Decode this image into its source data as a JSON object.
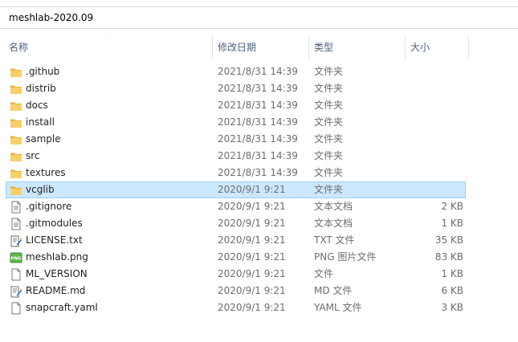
{
  "path": {
    "label": "meshlab-2020.09"
  },
  "columns": {
    "name": "名称",
    "date": "修改日期",
    "type": "类型",
    "size": "大小"
  },
  "files": [
    {
      "name": ".github",
      "date": "2021/8/31 14:39",
      "type": "文件夹",
      "size": "",
      "icon": "folder-icon"
    },
    {
      "name": "distrib",
      "date": "2021/8/31 14:39",
      "type": "文件夹",
      "size": "",
      "icon": "folder-icon"
    },
    {
      "name": "docs",
      "date": "2021/8/31 14:39",
      "type": "文件夹",
      "size": "",
      "icon": "folder-icon"
    },
    {
      "name": "install",
      "date": "2021/8/31 14:39",
      "type": "文件夹",
      "size": "",
      "icon": "folder-icon"
    },
    {
      "name": "sample",
      "date": "2021/8/31 14:39",
      "type": "文件夹",
      "size": "",
      "icon": "folder-icon"
    },
    {
      "name": "src",
      "date": "2021/8/31 14:39",
      "type": "文件夹",
      "size": "",
      "icon": "folder-icon"
    },
    {
      "name": "textures",
      "date": "2021/8/31 14:39",
      "type": "文件夹",
      "size": "",
      "icon": "folder-icon"
    },
    {
      "name": "vcglib",
      "date": "2020/9/1 9:21",
      "type": "文件夹",
      "size": "",
      "icon": "folder-icon",
      "selected": true
    },
    {
      "name": ".gitignore",
      "date": "2020/9/1 9:21",
      "type": "文本文档",
      "size": "2 KB",
      "icon": "text-file-icon"
    },
    {
      "name": ".gitmodules",
      "date": "2020/9/1 9:21",
      "type": "文本文档",
      "size": "1 KB",
      "icon": "text-file-icon"
    },
    {
      "name": "LICENSE.txt",
      "date": "2020/9/1 9:21",
      "type": "TXT 文件",
      "size": "35 KB",
      "icon": "edit-file-icon"
    },
    {
      "name": "meshlab.png",
      "date": "2020/9/1 9:21",
      "type": "PNG 图片文件",
      "size": "83 KB",
      "icon": "png-image-icon"
    },
    {
      "name": "ML_VERSION",
      "date": "2020/9/1 9:21",
      "type": "文件",
      "size": "1 KB",
      "icon": "blank-file-icon"
    },
    {
      "name": "README.md",
      "date": "2020/9/1 9:21",
      "type": "MD 文件",
      "size": "6 KB",
      "icon": "edit-file-icon"
    },
    {
      "name": "snapcraft.yaml",
      "date": "2020/9/1 9:21",
      "type": "YAML 文件",
      "size": "3 KB",
      "icon": "blank-file-icon"
    }
  ],
  "colors": {
    "selection_bg": "#cce8ff",
    "selection_border": "#99d1ff",
    "folder": "#f4c75a",
    "header_text": "#4d6082"
  }
}
